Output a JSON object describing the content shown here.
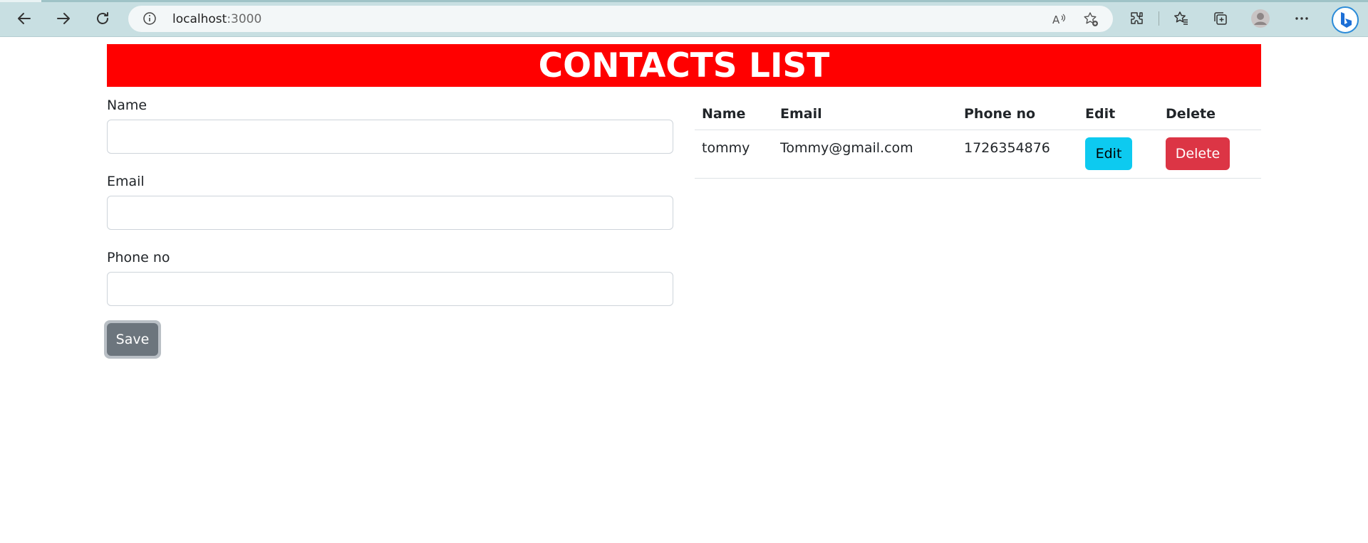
{
  "browser": {
    "url_host": "localhost",
    "url_port": ":3000"
  },
  "page": {
    "banner_title": "CONTACTS LIST"
  },
  "form": {
    "name_label": "Name",
    "email_label": "Email",
    "phone_label": "Phone no",
    "name_value": "",
    "email_value": "",
    "phone_value": "",
    "save_label": "Save"
  },
  "table": {
    "headers": [
      "Name",
      "Email",
      "Phone no",
      "Edit",
      "Delete"
    ],
    "rows": [
      {
        "name": "tommy",
        "email": "Tommy@gmail.com",
        "phone": "1726354876",
        "edit_label": "Edit",
        "delete_label": "Delete"
      }
    ]
  },
  "colors": {
    "banner_bg": "#ff0000",
    "edit_bg": "#0dcaf0",
    "delete_bg": "#dc3545",
    "save_bg": "#6c757d"
  }
}
